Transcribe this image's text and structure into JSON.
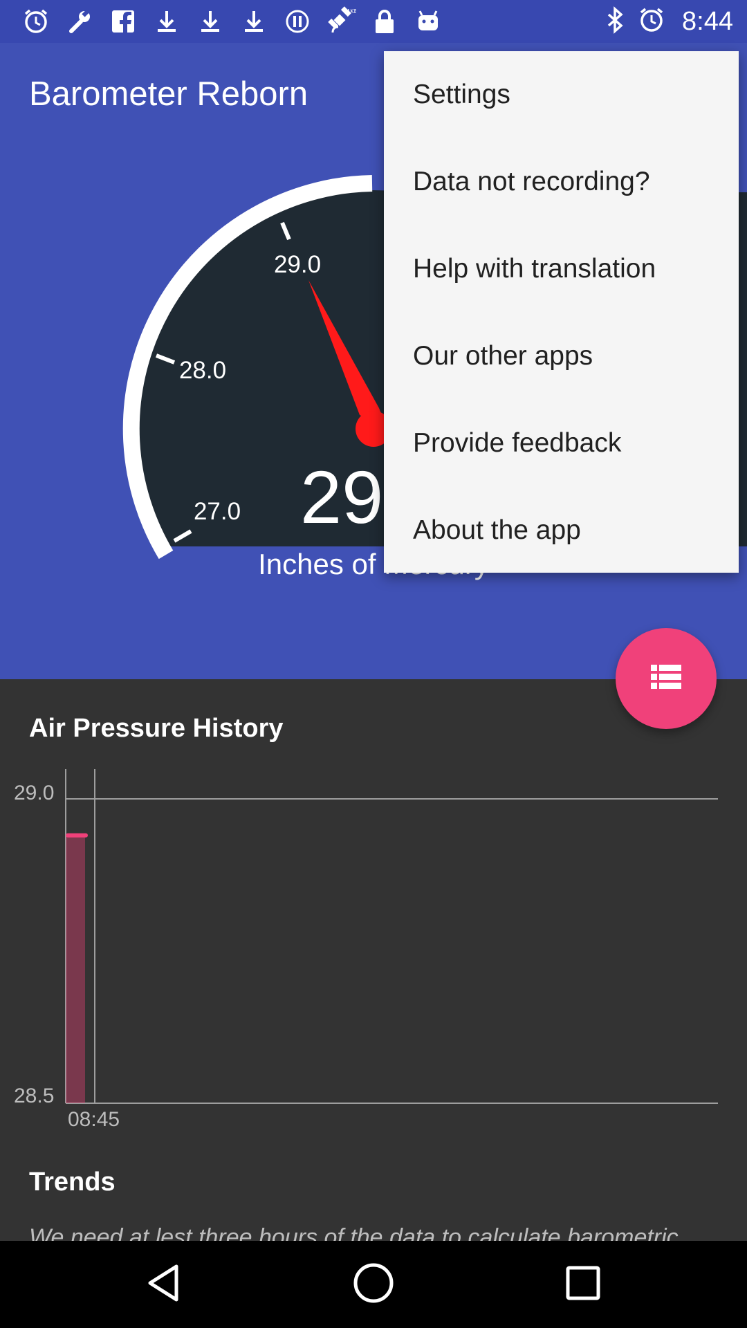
{
  "status_bar": {
    "time": "8:44",
    "left_icons": [
      "alarm-icon",
      "wrench-icon",
      "facebook-icon",
      "download-icon",
      "download-icon",
      "download-icon",
      "vpn-icon",
      "satellite-fake-gps-icon",
      "lock-icon",
      "android-icon"
    ],
    "right_icons": [
      "bluetooth-icon",
      "alarm-icon"
    ]
  },
  "app": {
    "title": "Barometer Reborn"
  },
  "gauge": {
    "tick_labels": [
      "29.0",
      "28.0",
      "27.0"
    ],
    "reading_partial": "29",
    "unit": "Inches of Mercury",
    "needle_color": "#ff1a1a"
  },
  "overflow_menu": {
    "items": [
      "Settings",
      "Data not recording?",
      "Help with translation",
      "Our other apps",
      "Provide feedback",
      "About the app"
    ]
  },
  "history": {
    "title": "Air Pressure History",
    "chart_data": {
      "type": "bar",
      "title": "Air Pressure History",
      "ylim": [
        28.5,
        29.0
      ],
      "y_ticks": [
        "29.0",
        "28.5"
      ],
      "x_ticks": [
        "08:45"
      ],
      "series": [
        {
          "values": [
            28.94
          ]
        }
      ],
      "bar_color": "#f0417a"
    }
  },
  "trends": {
    "title": "Trends",
    "text": "We need at lest three hours of the data to calculate barometric"
  },
  "navigation": {
    "back_icon": "back-triangle-icon",
    "home_icon": "home-circle-icon",
    "recents_icon": "recents-square-icon"
  }
}
